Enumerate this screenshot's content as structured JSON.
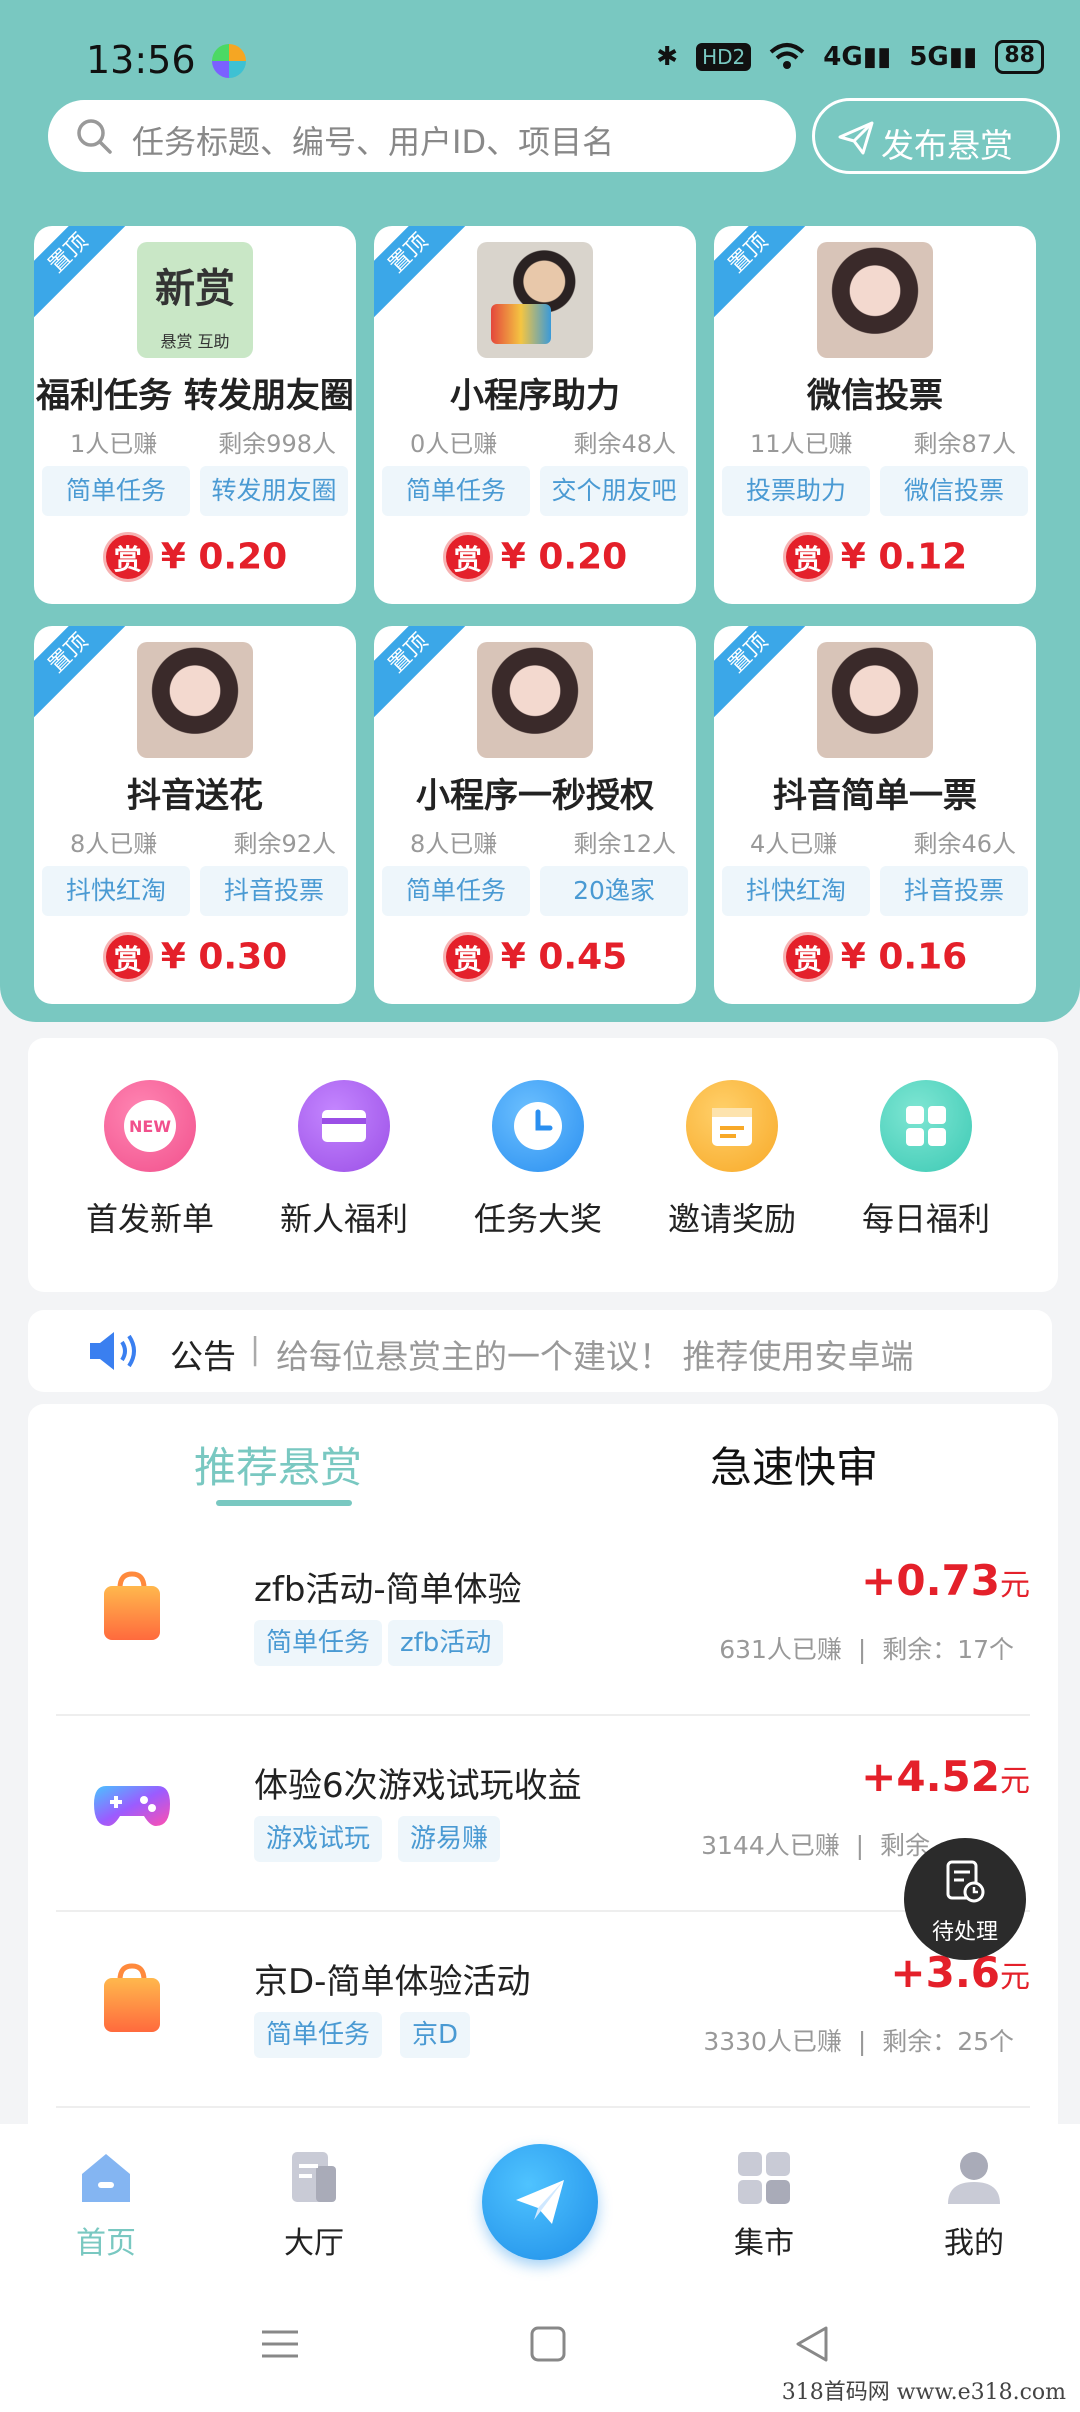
{
  "status": {
    "time": "13:56",
    "hd": "HD2",
    "net1": "4G",
    "net2": "5G",
    "battery": "88"
  },
  "search": {
    "placeholder": "任务标题、编号、用户ID、项目名"
  },
  "publish_label": "发布悬赏",
  "pinned_label": "置顶",
  "reward_badge": "赏",
  "thumb_xin": {
    "big": "新赏",
    "small": "悬赏 互助"
  },
  "cards": [
    {
      "title": "福利任务 转发朋友圈",
      "earned": "1人已赚",
      "remain": "剩余998人",
      "tags": [
        "简单任务",
        "转发朋友圈"
      ],
      "reward": "¥ 0.20"
    },
    {
      "title": "小程序助力",
      "earned": "0人已赚",
      "remain": "剩余48人",
      "tags": [
        "简单任务",
        "交个朋友吧"
      ],
      "reward": "¥ 0.20"
    },
    {
      "title": "微信投票",
      "earned": "11人已赚",
      "remain": "剩余87人",
      "tags": [
        "投票助力",
        "微信投票"
      ],
      "reward": "¥ 0.12"
    },
    {
      "title": "抖音送花",
      "earned": "8人已赚",
      "remain": "剩余92人",
      "tags": [
        "抖快红淘",
        "抖音投票"
      ],
      "reward": "¥ 0.30"
    },
    {
      "title": "小程序一秒授权",
      "earned": "8人已赚",
      "remain": "剩余12人",
      "tags": [
        "简单任务",
        "20逸家"
      ],
      "reward": "¥ 0.45"
    },
    {
      "title": "抖音简单一票",
      "earned": "4人已赚",
      "remain": "剩余46人",
      "tags": [
        "抖快红淘",
        "抖音投票"
      ],
      "reward": "¥ 0.16"
    }
  ],
  "quick": [
    {
      "label": "首发新单",
      "icon": "new-badge-icon",
      "color": "#f1508c",
      "badge": "NEW"
    },
    {
      "label": "新人福利",
      "icon": "card-icon",
      "color": "#9b4fe6"
    },
    {
      "label": "任务大奖",
      "icon": "clock-icon",
      "color": "#2a8ff0"
    },
    {
      "label": "邀请奖励",
      "icon": "calendar-icon",
      "color": "#f8a928"
    },
    {
      "label": "每日福利",
      "icon": "grid-icon",
      "color": "#3cc9b4"
    }
  ],
  "notice": {
    "title": "公告",
    "sep": "|",
    "message": "给每位悬赏主的一个建议！ 推荐使用安卓端"
  },
  "tabs": {
    "active": "推荐悬赏",
    "inactive": "急速快审"
  },
  "tasks": [
    {
      "name": "zfb活动-简单体验",
      "tags": [
        "简单任务",
        "zfb活动"
      ],
      "price": "+0.73",
      "unit": "元",
      "earned": "631人已赚",
      "sep": "|",
      "remain": "剩余：17个",
      "icon": "shopping-bag-icon"
    },
    {
      "name": "体验6次游戏试玩收益",
      "tags": [
        "游戏试玩",
        "游易赚"
      ],
      "price": "+4.52",
      "unit": "元",
      "earned": "3144人已赚",
      "sep": "|",
      "remain": "剩余",
      "icon": "gamepad-icon"
    },
    {
      "name": "京D-简单体验活动",
      "tags": [
        "简单任务",
        "京D"
      ],
      "price": "+3.6",
      "unit": "元",
      "earned": "3330人已赚",
      "sep": "|",
      "remain": "剩余：25个",
      "icon": "shopping-bag-icon"
    }
  ],
  "pending_label": "待处理",
  "nav": {
    "home": "首页",
    "hall": "大厅",
    "market": "集市",
    "mine": "我的"
  },
  "watermark": "318首码网 www.e318.com"
}
